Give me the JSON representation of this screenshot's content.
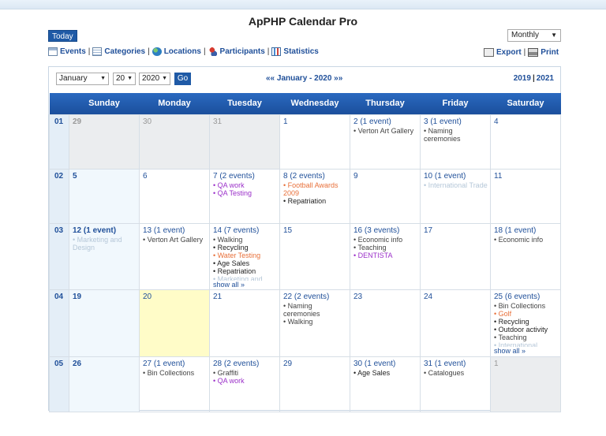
{
  "title": "ApPHP Calendar Pro",
  "today_label": "Today",
  "view_select": "Monthly",
  "nav": [
    "Events",
    "Categories",
    "Locations",
    "Participants",
    "Statistics"
  ],
  "export_label": "Export",
  "print_label": "Print",
  "controls": {
    "month": "January",
    "day": "20",
    "year": "2020",
    "go": "Go",
    "period": "«« January - 2020 »»",
    "prev_year": "2019",
    "next_year": "2021"
  },
  "colors": {
    "header_blue": "#1f5aa6",
    "link_blue": "#1f4f99",
    "orange": "#e8703a",
    "purple": "#9b30c9",
    "today_bg": "#fffcc8"
  },
  "weekdays": [
    "Sunday",
    "Monday",
    "Tuesday",
    "Wednesday",
    "Thursday",
    "Friday",
    "Saturday"
  ],
  "weeks": [
    {
      "num": "01",
      "days": [
        {
          "label": "29",
          "other": true,
          "events": []
        },
        {
          "label": "30",
          "other": true,
          "events": []
        },
        {
          "label": "31",
          "other": true,
          "events": []
        },
        {
          "label": "1",
          "events": []
        },
        {
          "label": "2 (1 event)",
          "events": [
            {
              "text": "• Verton Art Gallery",
              "color": "#444"
            }
          ]
        },
        {
          "label": "3 (1 event)",
          "events": [
            {
              "text": "• Naming ceremonies",
              "color": "#444",
              "wrap": true
            }
          ]
        },
        {
          "label": "4",
          "events": []
        }
      ]
    },
    {
      "num": "02",
      "days": [
        {
          "label": "5",
          "events": []
        },
        {
          "label": "6",
          "events": []
        },
        {
          "label": "7 (2 events)",
          "events": [
            {
              "text": "• QA work",
              "color": "#9b30c9"
            },
            {
              "text": "• QA Testing",
              "color": "#9b30c9"
            }
          ]
        },
        {
          "label": "8 (2 events)",
          "events": [
            {
              "text": "• Football Awards 2009",
              "color": "#e8703a",
              "wrap": true
            },
            {
              "text": "• Repatriation",
              "color": "#222"
            }
          ]
        },
        {
          "label": "9",
          "events": []
        },
        {
          "label": "10 (1 event)",
          "events": [
            {
              "text": "• International Trade",
              "color": "#b5c7d8"
            }
          ]
        },
        {
          "label": "11",
          "events": []
        }
      ]
    },
    {
      "num": "03",
      "days": [
        {
          "label": "12 (1 event)",
          "events": [
            {
              "text": "• Marketing and Design",
              "color": "#b5c7d8",
              "wrap": true
            }
          ]
        },
        {
          "label": "13 (1 event)",
          "events": [
            {
              "text": "• Verton Art Gallery",
              "color": "#444"
            }
          ]
        },
        {
          "label": "14 (7 events)",
          "events": [
            {
              "text": "• Walking",
              "color": "#444"
            },
            {
              "text": "• Recycling",
              "color": "#222"
            },
            {
              "text": "• Water Testing",
              "color": "#e8703a"
            },
            {
              "text": "• Age Sales",
              "color": "#222"
            },
            {
              "text": "• Repatriation",
              "color": "#222"
            },
            {
              "text": "• Marketing and",
              "color": "#b5c7d8"
            }
          ],
          "show_all": "show all »"
        },
        {
          "label": "15",
          "events": []
        },
        {
          "label": "16 (3 events)",
          "events": [
            {
              "text": "• Economic info",
              "color": "#444"
            },
            {
              "text": "• Teaching",
              "color": "#444"
            },
            {
              "text": "• DENTISTA",
              "color": "#9b30c9"
            }
          ]
        },
        {
          "label": "17",
          "events": []
        },
        {
          "label": "18 (1 event)",
          "events": [
            {
              "text": "• Economic info",
              "color": "#444"
            }
          ]
        }
      ]
    },
    {
      "num": "04",
      "days": [
        {
          "label": "19",
          "events": []
        },
        {
          "label": "20",
          "today": true,
          "events": []
        },
        {
          "label": "21",
          "events": []
        },
        {
          "label": "22 (2 events)",
          "events": [
            {
              "text": "• Naming ceremonies",
              "color": "#444",
              "wrap": true
            },
            {
              "text": "• Walking",
              "color": "#444"
            }
          ]
        },
        {
          "label": "23",
          "events": []
        },
        {
          "label": "24",
          "events": []
        },
        {
          "label": "25 (6 events)",
          "events": [
            {
              "text": "• Bin Collections",
              "color": "#444"
            },
            {
              "text": "• Golf",
              "color": "#e8703a"
            },
            {
              "text": "• Recycling",
              "color": "#222"
            },
            {
              "text": "• Outdoor activity",
              "color": "#222"
            },
            {
              "text": "• Teaching",
              "color": "#444"
            },
            {
              "text": "• International",
              "color": "#b5c7d8"
            }
          ],
          "show_all": "show all »"
        }
      ]
    },
    {
      "num": "05",
      "days": [
        {
          "label": "26",
          "events": []
        },
        {
          "label": "27 (1 event)",
          "events": [
            {
              "text": "• Bin Collections",
              "color": "#444"
            }
          ]
        },
        {
          "label": "28 (2 events)",
          "events": [
            {
              "text": "• Graffiti",
              "color": "#444"
            },
            {
              "text": "• QA work",
              "color": "#9b30c9"
            }
          ]
        },
        {
          "label": "29",
          "events": []
        },
        {
          "label": "30 (1 event)",
          "events": [
            {
              "text": "• Age Sales",
              "color": "#222"
            }
          ]
        },
        {
          "label": "31 (1 event)",
          "events": [
            {
              "text": "• Catalogues",
              "color": "#444"
            }
          ]
        },
        {
          "label": "1",
          "other": true,
          "events": []
        }
      ]
    }
  ]
}
